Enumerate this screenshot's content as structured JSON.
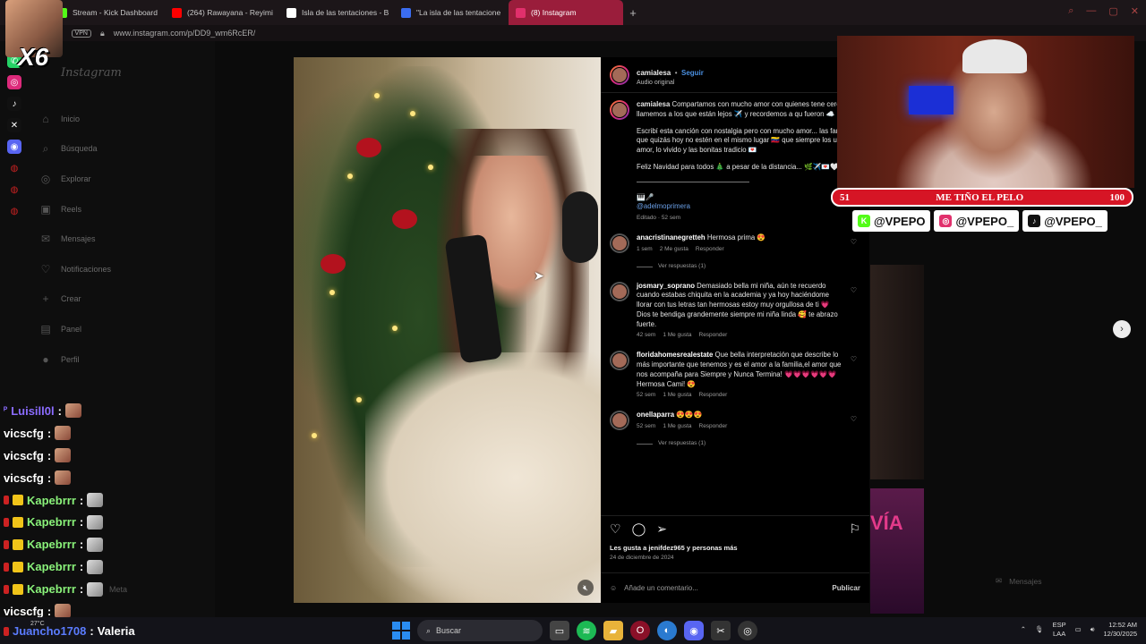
{
  "browser": {
    "tabs": [
      {
        "title": "Stream - Kick Dashboard",
        "color": "#53fc18",
        "active": false
      },
      {
        "title": "(264) Rawayana - Reyimi",
        "color": "#ff0000",
        "active": false
      },
      {
        "title": "Isla de las tentaciones - B",
        "color": "#ffffff",
        "active": false
      },
      {
        "title": "\"La isla de las tentacione",
        "color": "#3b6df0",
        "active": false
      },
      {
        "title": "(8) Instagram",
        "color": "#e1306c",
        "active": true
      }
    ],
    "url": "www.instagram.com/p/DD9_wm6RcER/",
    "vpn_label": "VPN"
  },
  "instagram": {
    "logo": "Instagram",
    "nav": [
      {
        "label": "Inicio",
        "icon": "home-icon",
        "glyph": "⌂"
      },
      {
        "label": "Búsqueda",
        "icon": "search-icon",
        "glyph": "⌕"
      },
      {
        "label": "Explorar",
        "icon": "compass-icon",
        "glyph": "◎"
      },
      {
        "label": "Reels",
        "icon": "reels-icon",
        "glyph": "▣"
      },
      {
        "label": "Mensajes",
        "icon": "messages-icon",
        "glyph": "✉"
      },
      {
        "label": "Notificaciones",
        "icon": "heart-icon",
        "glyph": "♡"
      },
      {
        "label": "Crear",
        "icon": "plus-icon",
        "glyph": "+"
      },
      {
        "label": "Panel",
        "icon": "panel-icon",
        "glyph": "▤"
      },
      {
        "label": "Perfil",
        "icon": "profile-icon",
        "glyph": "●"
      }
    ],
    "more_label": "Meta",
    "post": {
      "author": "camialesa",
      "follow": "Seguir",
      "audio": "Audio original",
      "caption": [
        "Compartamos con mucho amor con quienes tene cerca, llamemos a los que están lejos ✈️ y recordemos a qu fueron ☁️ 🤍",
        "Escribí esta canción con nostalgia pero con mucho amor... las familias que quizás hoy no estén en el mismo lugar 🇻🇪 que siempre los une el amor, lo vivido y las bonitas tradicio 💌",
        "Feliz Navidad para todos 🎄 a pesar de la distancia... 🌿✈️💌🤍"
      ],
      "credit_icons": "🎹🎤",
      "credit": "@adelmoprimera",
      "edited": "Editado · 52 sem",
      "comments": [
        {
          "user": "anacristinanegretteh",
          "text": "Hermosa prima 😍",
          "time": "1 sem",
          "likes": "2 Me gusta",
          "reply": "Responder",
          "replies": "Ver respuestas (1)"
        },
        {
          "user": "josmary_soprano",
          "text": "Demasiado bella mi niña, aún te recuerdo cuando estabas chiquita en la academia y ya hoy haciéndome llorar con tus letras tan hermosas estoy muy orgullosa de ti 💗 Dios te bendiga grandemente siempre mi niña linda 🥰 te abrazo fuerte.",
          "time": "42 sem",
          "likes": "1 Me gusta",
          "reply": "Responder",
          "replies": ""
        },
        {
          "user": "floridahomesrealestate",
          "text": "Que bella interpretación que describe lo más importante que tenemos y es el amor a la familia,el amor que nos acompaña para Siempre y Nunca Termina! 💗💗💗💗💗💗 Hermosa Cami! 😍",
          "time": "52 sem",
          "likes": "1 Me gusta",
          "reply": "Responder",
          "replies": ""
        },
        {
          "user": "onellaparra",
          "text": "😍😍😍",
          "time": "52 sem",
          "likes": "1 Me gusta",
          "reply": "Responder",
          "replies": "Ver respuestas (1)"
        }
      ],
      "likes_text": "Les gusta a jenifdez965 y personas más",
      "date": "24 de diciembre de 2024",
      "add_comment_placeholder": "Añade un comentario...",
      "publish": "Publicar"
    },
    "bg_text": "VÍA",
    "messages_label": "Mensajes"
  },
  "overlay": {
    "goal_left": "51",
    "goal_title": "ME TIÑO EL PELO",
    "goal_right": "100",
    "socials": [
      {
        "label": "@VPEPO",
        "icon": "kick-icon",
        "glyph": "K",
        "color": "#53fc18"
      },
      {
        "label": "@VPEPO_",
        "icon": "instagram-icon",
        "glyph": "◎",
        "color": "#e1306c"
      },
      {
        "label": "@VPEPO_",
        "icon": "tiktok-icon",
        "glyph": "♪",
        "color": "#111111"
      }
    ],
    "multiplier": "X6"
  },
  "chat": [
    {
      "user": "Luisill0l",
      "color": "#8b6cff",
      "badge": "none",
      "emote": "face"
    },
    {
      "user": "vicscfg",
      "color": "#ffffff",
      "badge": "none",
      "emote": "face"
    },
    {
      "user": "vicscfg",
      "color": "#ffffff",
      "badge": "none",
      "emote": "face"
    },
    {
      "user": "vicscfg",
      "color": "#ffffff",
      "badge": "none",
      "emote": "face"
    },
    {
      "user": "Kapebrrr",
      "color": "#8af27a",
      "badge": "gold",
      "emote": "cat"
    },
    {
      "user": "Kapebrrr",
      "color": "#8af27a",
      "badge": "gold",
      "emote": "cat"
    },
    {
      "user": "Kapebrrr",
      "color": "#8af27a",
      "badge": "gold",
      "emote": "cat"
    },
    {
      "user": "Kapebrrr",
      "color": "#8af27a",
      "badge": "gold",
      "emote": "cat"
    },
    {
      "user": "Kapebrrr",
      "color": "#8af27a",
      "badge": "gold",
      "emote": "cat"
    },
    {
      "user": "vicscfg",
      "color": "#ffffff",
      "badge": "none",
      "emote": "face"
    }
  ],
  "last_chat": {
    "user": "Juancho1708",
    "color": "#5b7cff",
    "message": "Valeria"
  },
  "taskbar": {
    "weather": "27°C",
    "search_label": "Buscar",
    "lang_top": "ESP",
    "lang_bottom": "LAA",
    "time": "12:52 AM",
    "date": "12/30/2025"
  }
}
